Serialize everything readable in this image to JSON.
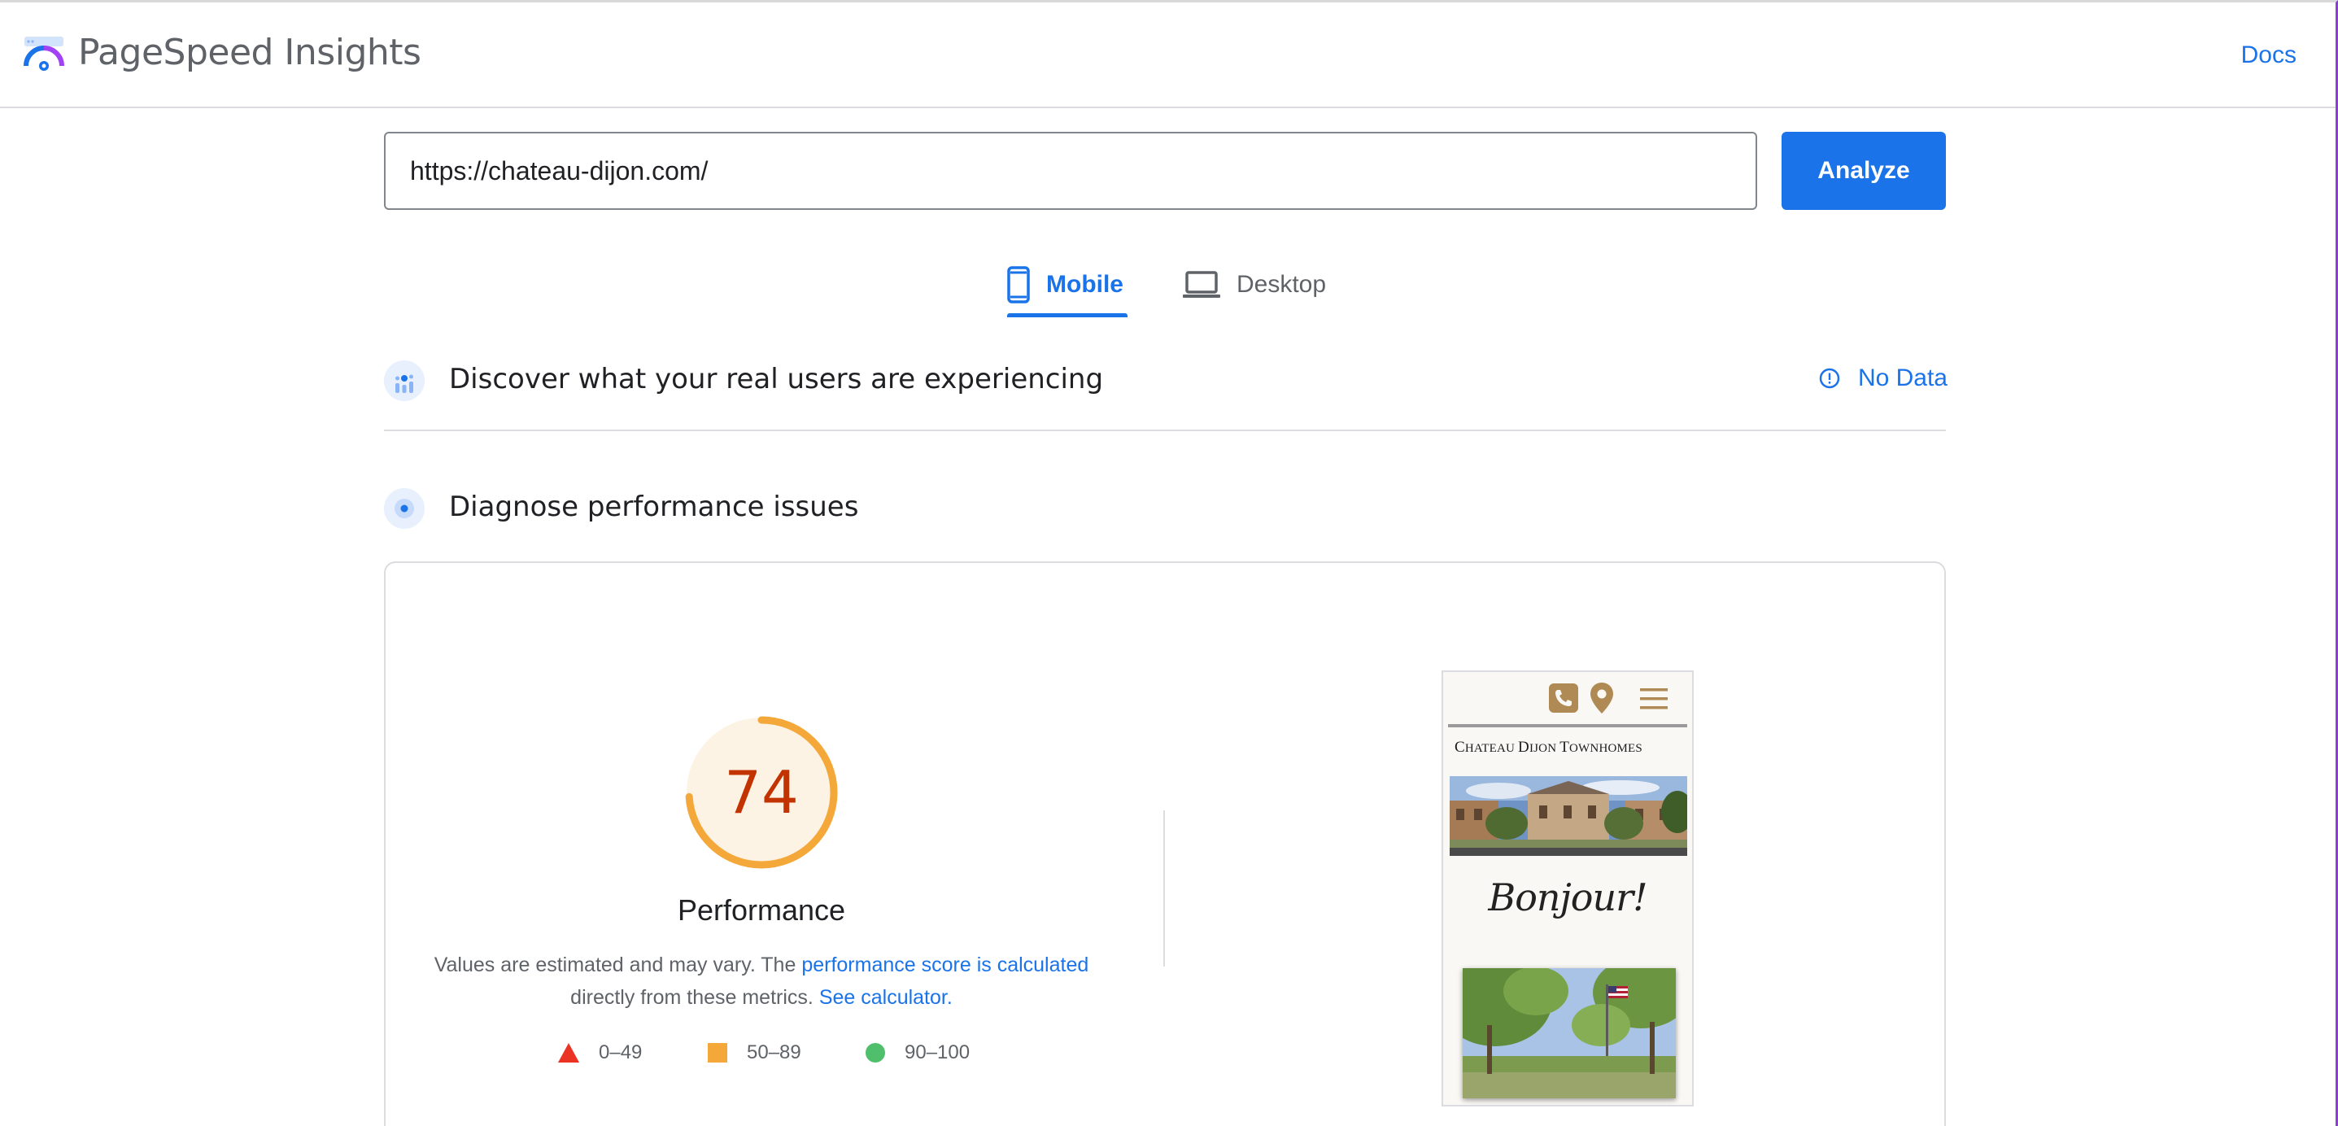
{
  "header": {
    "app_title": "PageSpeed Insights",
    "docs_label": "Docs"
  },
  "search": {
    "url_value": "https://chateau-dijon.com/",
    "analyze_label": "Analyze"
  },
  "tabs": [
    {
      "label": "Mobile",
      "icon": "smartphone-icon",
      "active": true
    },
    {
      "label": "Desktop",
      "icon": "laptop-icon",
      "active": false
    }
  ],
  "sections": {
    "discover": {
      "title": "Discover what your real users are experiencing",
      "status_label": "No Data"
    },
    "diagnose": {
      "title": "Diagnose performance issues"
    }
  },
  "performance": {
    "score": "74",
    "score_fraction": 0.74,
    "title": "Performance",
    "desc_text_1": "Values are estimated and may vary. The ",
    "desc_link_1": "performance score is calculated",
    "desc_text_2": " directly from these metrics. ",
    "desc_link_2": "See calculator.",
    "legend": [
      {
        "range": "0–49",
        "shape": "triangle",
        "color": "#eb3323"
      },
      {
        "range": "50–89",
        "shape": "square",
        "color": "#f4a83a"
      },
      {
        "range": "90–100",
        "shape": "circle",
        "color": "#4fbf6c"
      }
    ]
  },
  "screenshot": {
    "site_title_1": "C",
    "site_title_2": "hateau ",
    "site_title_3": "D",
    "site_title_4": "ijon ",
    "site_title_5": "T",
    "site_title_6": "ownhomes",
    "greeting": "Bonjour!"
  },
  "colors": {
    "accent": "#1a73e8",
    "score_orange": "#f4a83a",
    "score_text": "#c33300",
    "brand_gold": "#b08a55"
  }
}
